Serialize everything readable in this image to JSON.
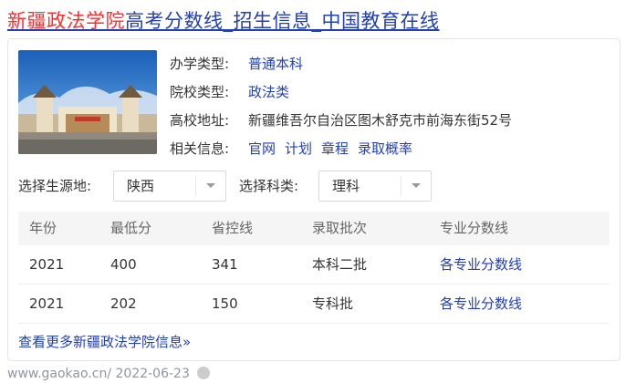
{
  "title": {
    "highlight": "新疆政法学院",
    "rest": "高考分数线_招生信息_中国教育在线"
  },
  "info": [
    {
      "label": "办学类型:",
      "value": "普通本科",
      "link": true
    },
    {
      "label": "院校类型:",
      "value": "政法类",
      "link": true
    },
    {
      "label": "高校地址:",
      "value": "新疆维吾尔自治区图木舒克市前海东街52号",
      "link": false
    }
  ],
  "related": {
    "label": "相关信息:",
    "links": [
      "官网",
      "计划",
      "章程",
      "录取概率"
    ]
  },
  "filters": {
    "origin_label": "选择生源地:",
    "origin_value": "陕西",
    "subject_label": "选择科类:",
    "subject_value": "理科"
  },
  "table": {
    "headers": [
      "年份",
      "最低分",
      "省控线",
      "录取批次",
      "专业分数线"
    ],
    "rows": [
      [
        "2021",
        "400",
        "341",
        "本科二批",
        "各专业分数线"
      ],
      [
        "2021",
        "202",
        "150",
        "专科批",
        "各专业分数线"
      ]
    ]
  },
  "more_link": "查看更多新疆政法学院信息»",
  "footer": {
    "url": "www.gaokao.cn/",
    "date": "2022-06-23"
  },
  "colors": {
    "link": "#2440b3",
    "highlight": "#f73131",
    "footer": "#9195a3"
  }
}
